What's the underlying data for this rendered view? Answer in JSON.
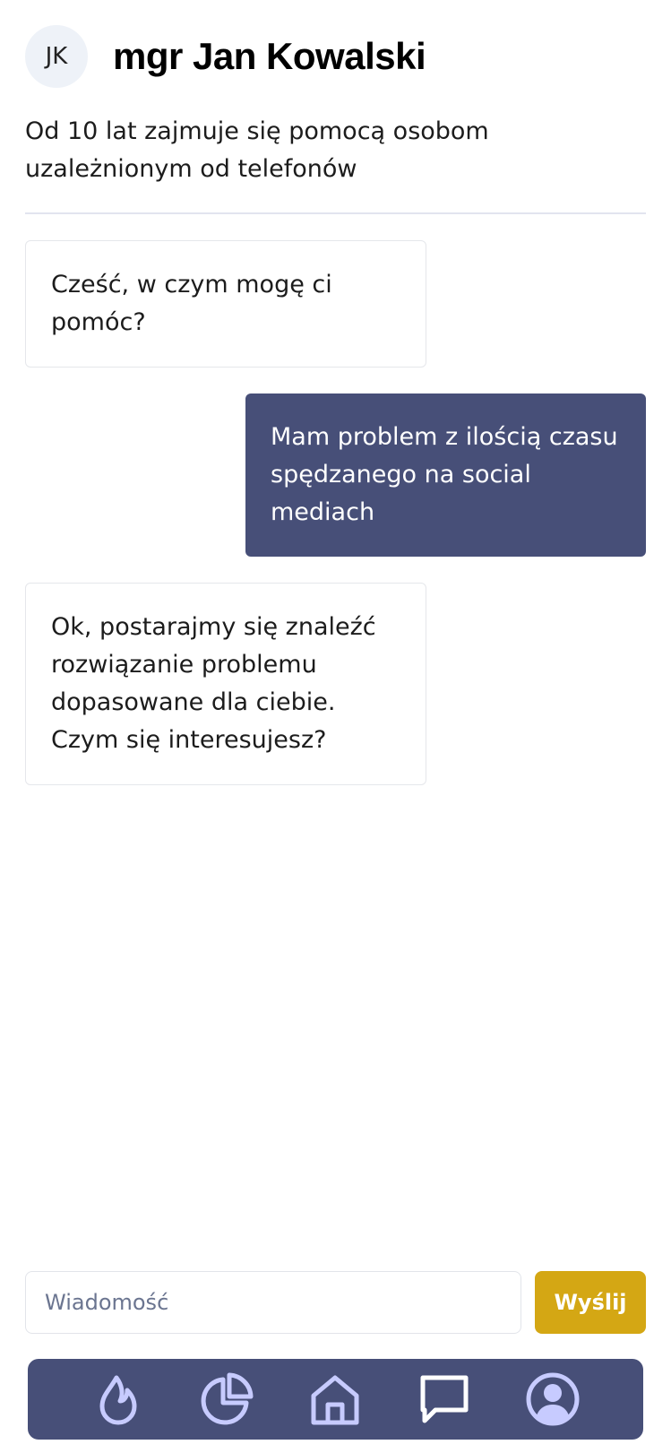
{
  "header": {
    "avatar_initials": "JK",
    "name": "mgr Jan Kowalski",
    "bio": "Od 10 lat zajmuje się pomocą osobom uzależnionym od telefonów"
  },
  "messages": [
    {
      "from": "therapist",
      "text": "Cześć, w czym mogę ci pomóc?"
    },
    {
      "from": "user",
      "text": "Mam problem z ilością czasu spędzanego na social mediach"
    },
    {
      "from": "therapist",
      "text": "Ok, postarajmy się znaleźć rozwiązanie problemu dopasowane dla ciebie. Czym się interesujesz?"
    }
  ],
  "composer": {
    "placeholder": "Wiadomość",
    "value": "",
    "send_label": "Wyślij"
  },
  "nav": {
    "items": [
      {
        "icon": "flame-icon"
      },
      {
        "icon": "pie-chart-icon"
      },
      {
        "icon": "home-icon"
      },
      {
        "icon": "chat-icon"
      },
      {
        "icon": "user-circle-icon"
      }
    ]
  },
  "colors": {
    "primary": "#474f78",
    "accent": "#d4a714",
    "icon": "#c7cbff",
    "avatar_bg": "#eef2f8"
  }
}
